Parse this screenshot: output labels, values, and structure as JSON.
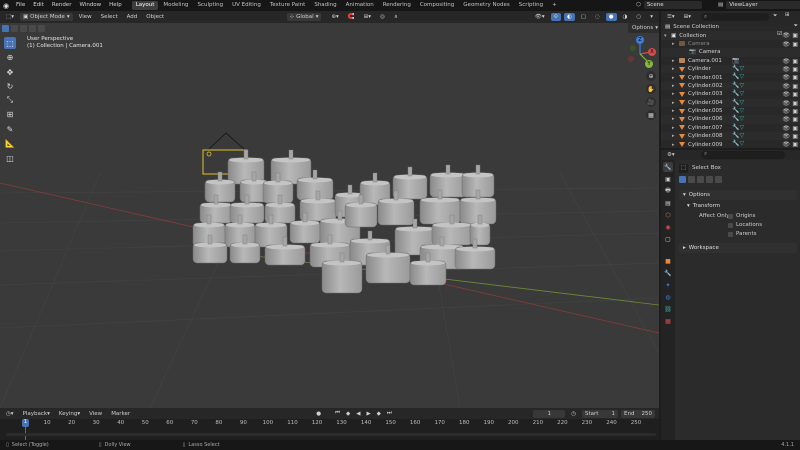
{
  "topbar": {
    "menus": [
      "File",
      "Edit",
      "Render",
      "Window",
      "Help"
    ],
    "workspaces": [
      "Layout",
      "Modeling",
      "Sculpting",
      "UV Editing",
      "Texture Paint",
      "Shading",
      "Animation",
      "Rendering",
      "Compositing",
      "Geometry Nodes",
      "Scripting"
    ],
    "active_workspace": "Layout",
    "add_tab": "+",
    "scene": "Scene",
    "view_layer": "ViewLayer"
  },
  "viewport_header": {
    "mode": "Object Mode",
    "menus": [
      "View",
      "Select",
      "Add",
      "Object"
    ],
    "orientation": "Global",
    "options": "Options"
  },
  "viewport": {
    "perspective": "User Perspective",
    "collection": "(1) Collection | Camera.001",
    "gizmo": {
      "x": "X",
      "y": "Y",
      "z": "Z"
    }
  },
  "timeline": {
    "menus": [
      "Playback",
      "Keying",
      "View",
      "Marker"
    ],
    "current_frame": "1",
    "start_label": "Start",
    "start": "1",
    "end_label": "End",
    "end": "250",
    "ruler": [
      "1",
      "10",
      "20",
      "30",
      "40",
      "50",
      "60",
      "70",
      "80",
      "90",
      "100",
      "110",
      "120",
      "130",
      "140",
      "150",
      "160",
      "170",
      "180",
      "190",
      "200",
      "210",
      "220",
      "230",
      "240",
      "250"
    ]
  },
  "statusbar": {
    "select": "Select (Toggle)",
    "dolly": "Dolly View",
    "lasso": "Lasso Select",
    "version": "4.1.1"
  },
  "outliner": {
    "search_placeholder": "",
    "rows": [
      {
        "name": "Scene Collection",
        "kind": "scene"
      },
      {
        "name": "Collection",
        "kind": "collection"
      },
      {
        "name": "Camera",
        "kind": "camera-dim"
      },
      {
        "name": "Camera",
        "kind": "camera-data"
      },
      {
        "name": "Camera.001",
        "kind": "camera"
      },
      {
        "name": "Cylinder",
        "kind": "mesh"
      },
      {
        "name": "Cylinder.001",
        "kind": "mesh"
      },
      {
        "name": "Cylinder.002",
        "kind": "mesh"
      },
      {
        "name": "Cylinder.003",
        "kind": "mesh"
      },
      {
        "name": "Cylinder.004",
        "kind": "mesh"
      },
      {
        "name": "Cylinder.005",
        "kind": "mesh"
      },
      {
        "name": "Cylinder.006",
        "kind": "mesh"
      },
      {
        "name": "Cylinder.007",
        "kind": "mesh"
      },
      {
        "name": "Cylinder.008",
        "kind": "mesh"
      },
      {
        "name": "Cylinder.009",
        "kind": "mesh"
      }
    ]
  },
  "properties": {
    "tool": "Select Box",
    "options_panel": "Options",
    "transform_panel": "Transform",
    "affect_only": "Affect Only",
    "origins": "Origins",
    "locations": "Locations",
    "parents": "Parents",
    "workspace_panel": "Workspace"
  },
  "colors": {
    "accent": "#4772b3",
    "selection": "#e0c229",
    "mesh_orange": "#e8893a",
    "modifier_teal": "#3ab2a0",
    "x_axis": "#d34b4b",
    "y_axis": "#86b53d",
    "z_axis": "#3d7dd9"
  }
}
